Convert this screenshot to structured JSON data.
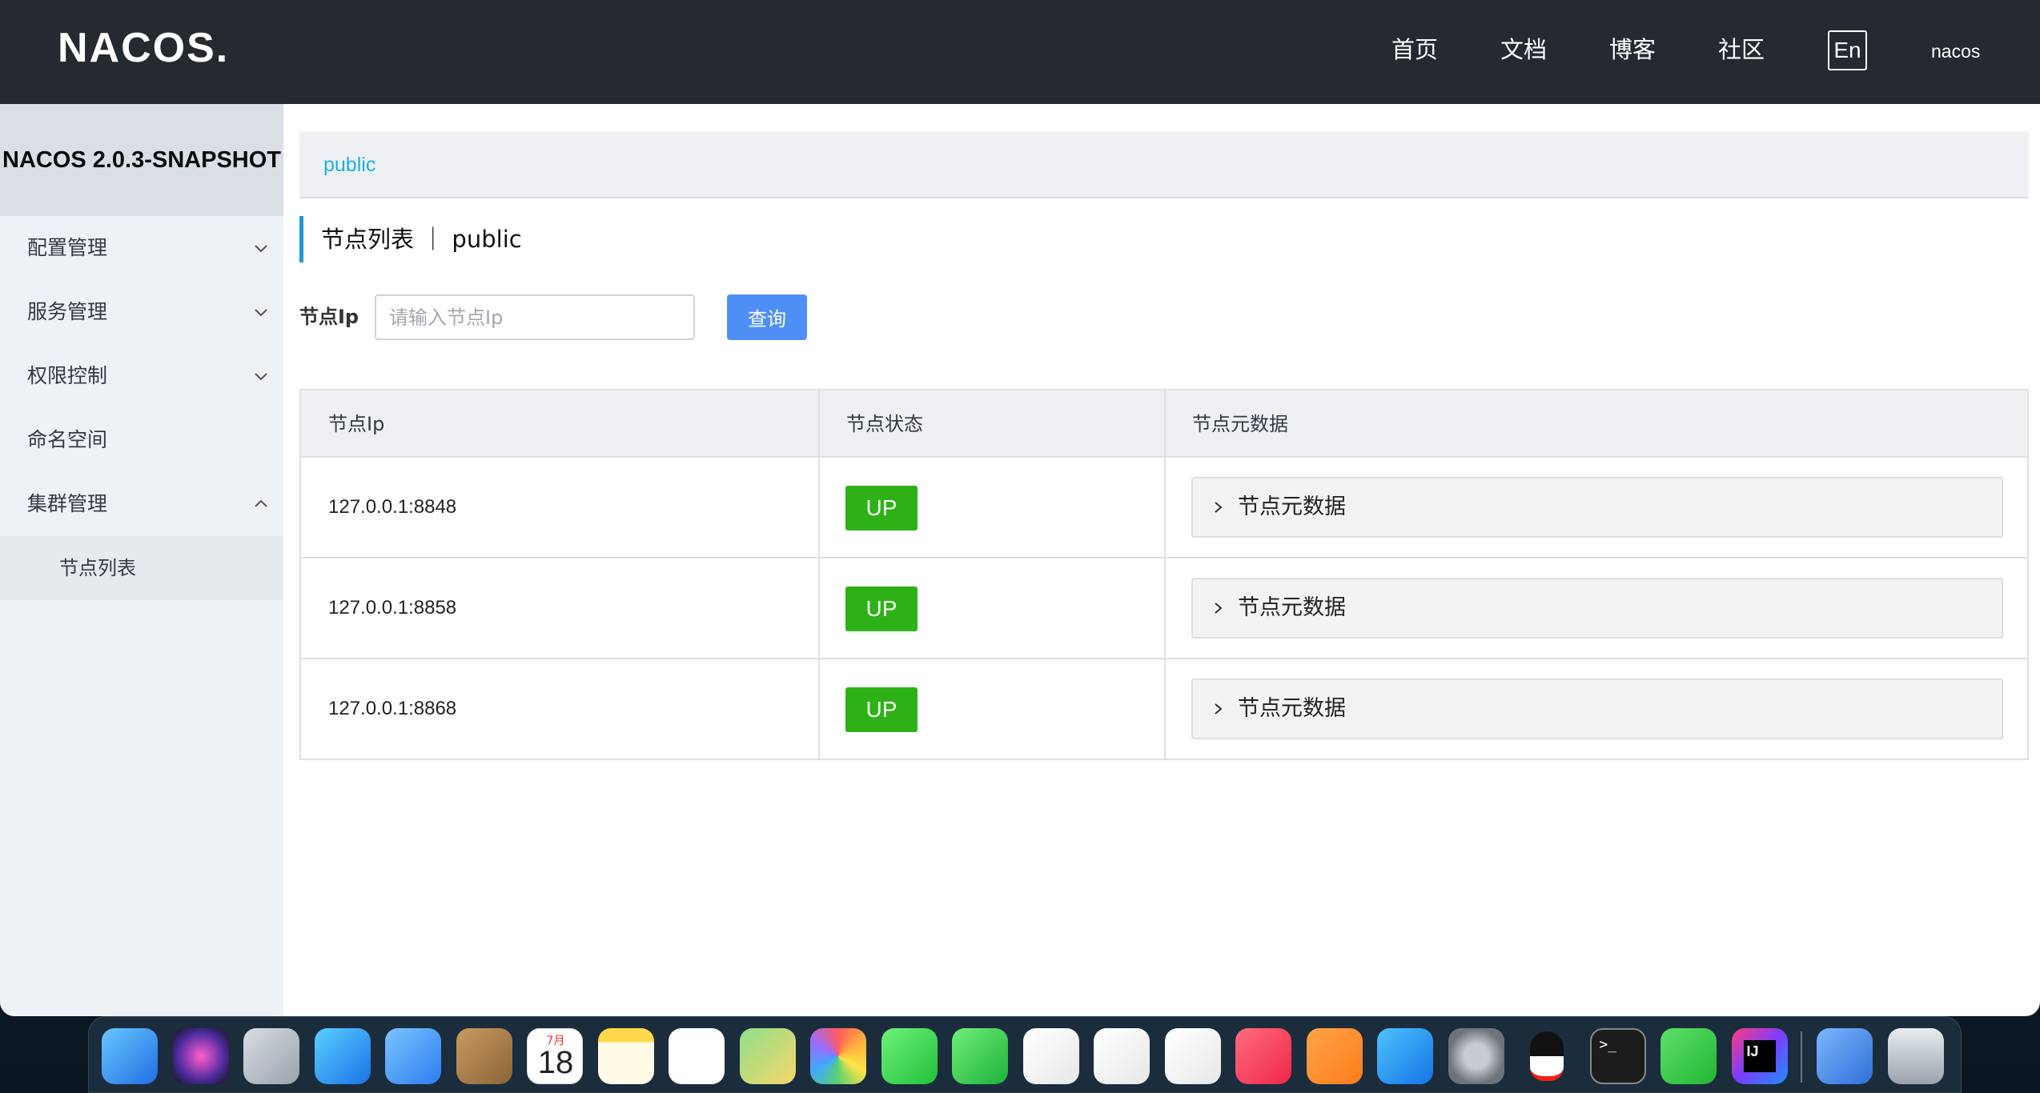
{
  "header": {
    "logo_text": "NACOS.",
    "nav": [
      "首页",
      "文档",
      "博客",
      "社区"
    ],
    "lang_button": "En",
    "user": "nacos"
  },
  "sidebar": {
    "version": "NACOS 2.0.3-SNAPSHOT",
    "items": [
      {
        "label": "配置管理",
        "chevron": "chevron-down-icon"
      },
      {
        "label": "服务管理",
        "chevron": "chevron-down-icon"
      },
      {
        "label": "权限控制",
        "chevron": "chevron-down-icon"
      },
      {
        "label": "命名空间"
      },
      {
        "label": "集群管理",
        "chevron": "chevron-up-icon"
      }
    ],
    "sub_item": "节点列表"
  },
  "main": {
    "namespace": "public",
    "title": "节点列表 ｜ public",
    "filter": {
      "label": "节点Ip",
      "placeholder": "请输入节点Ip",
      "value": "",
      "button": "查询"
    },
    "table": {
      "headers": [
        "节点Ip",
        "节点状态",
        "节点元数据"
      ],
      "rows": [
        {
          "ip": "127.0.0.1:8848",
          "status": "UP",
          "meta": "节点元数据"
        },
        {
          "ip": "127.0.0.1:8858",
          "status": "UP",
          "meta": "节点元数据"
        },
        {
          "ip": "127.0.0.1:8868",
          "status": "UP",
          "meta": "节点元数据"
        }
      ]
    }
  },
  "colors": {
    "topbar": "#252a30",
    "accent": "#1a9ad6",
    "link": "#1db1d8",
    "button": "#4f8ff5",
    "status_up": "#2eb116"
  },
  "dock": {
    "calendar_month": "7月",
    "calendar_day": "18",
    "apps": [
      "finder-icon",
      "siri-icon",
      "launchpad-icon",
      "safari-icon",
      "mail-icon",
      "contacts-icon",
      "calendar-icon",
      "notes-icon",
      "reminders-icon",
      "maps-icon",
      "photos-icon",
      "messages-icon",
      "facetime-icon",
      "pages-icon",
      "numbers-icon",
      "keynote-icon",
      "music-icon",
      "books-icon",
      "app-store-icon",
      "system-preferences-icon",
      "qq-icon",
      "terminal-icon",
      "wechat-icon",
      "intellij-icon",
      "coffee-icon",
      "trash-icon"
    ]
  }
}
